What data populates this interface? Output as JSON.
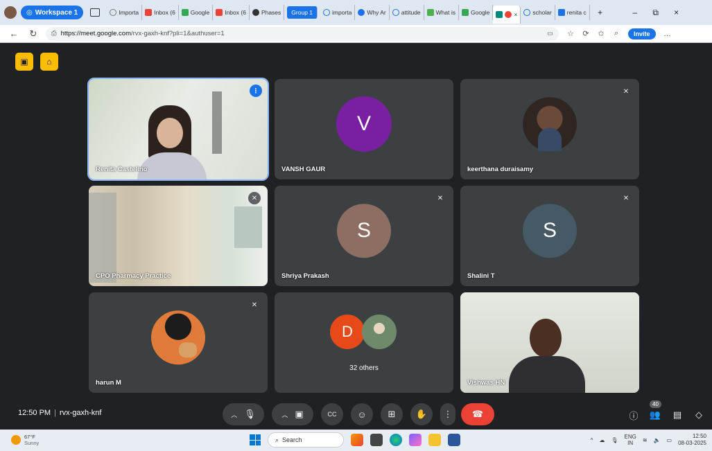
{
  "browser": {
    "workspace_label": "Workspace 1",
    "tabs": [
      {
        "label": "Importa",
        "icon": "globe-icon",
        "color": "#777777"
      },
      {
        "label": "Inbox (6",
        "icon": "gmail-icon",
        "color": "#ea4335"
      },
      {
        "label": "Google",
        "icon": "drive-icon",
        "color": "#34a853"
      },
      {
        "label": "Inbox (6",
        "icon": "gmail-icon",
        "color": "#ea4335"
      },
      {
        "label": "Phases",
        "icon": "app-icon",
        "color": "#333333"
      }
    ],
    "tab_group_label": "Group 1",
    "group_tabs": [
      {
        "label": "importa",
        "icon": "search-icon",
        "color": "#1a73e8"
      },
      {
        "label": "Why Ar",
        "icon": "info-icon",
        "color": "#1a73e8"
      },
      {
        "label": "attitude",
        "icon": "search-icon",
        "color": "#1a73e8"
      },
      {
        "label": "What is",
        "icon": "gt-icon",
        "color": "#4caf50"
      },
      {
        "label": "Google",
        "icon": "drive-icon",
        "color": "#34a853"
      }
    ],
    "active_tab_close": "×",
    "after_tabs": [
      {
        "label": "scholar",
        "icon": "search-icon",
        "color": "#1a73e8"
      },
      {
        "label": "renita c",
        "icon": "app-icon",
        "color": "#1a73e8"
      }
    ],
    "new_tab": "+",
    "window_controls": [
      "–",
      "⧉",
      "×"
    ],
    "url_domain": "https://meet.google.com",
    "url_path": "/rvx-gaxh-knf?pli=1&authuser=1",
    "invite_label": "Invite",
    "more_label": "…"
  },
  "participants": [
    {
      "name": "Renita Castelino",
      "type": "video",
      "speaking": true
    },
    {
      "name": "VANSH GAUR",
      "type": "avatar",
      "initial": "V",
      "color": "#7b1fa2"
    },
    {
      "name": "keerthana duraisamy",
      "type": "photo",
      "muted": true
    },
    {
      "name": "CPO Pharmacy Practice",
      "type": "video",
      "muted": true
    },
    {
      "name": "Shriya Prakash",
      "type": "avatar",
      "initial": "S",
      "color": "#8d6e63",
      "muted": true
    },
    {
      "name": "Shalini T",
      "type": "avatar",
      "initial": "S",
      "color": "#455a64",
      "muted": true
    },
    {
      "name": "harun M",
      "type": "photo",
      "muted": true
    },
    {
      "name": "32 others",
      "type": "others",
      "initial": "D",
      "color": "#e64a19"
    },
    {
      "name": "Vishwas HN",
      "type": "video"
    }
  ],
  "controls": {
    "time": "12:50 PM",
    "meeting_code": "rvx-gaxh-knf",
    "people_count": "40"
  },
  "taskbar": {
    "temperature": "67°F",
    "condition": "Sunny",
    "search_label": "Search",
    "language": "ENG",
    "region": "IN",
    "time": "12:50",
    "date": "08-03-2025"
  }
}
